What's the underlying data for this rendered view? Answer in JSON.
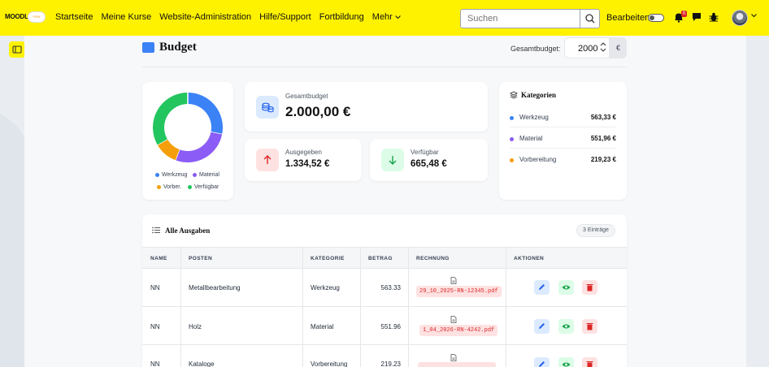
{
  "navbar": {
    "logo_text": "MOODLE",
    "logo_sub": "FRW",
    "links": [
      "Startseite",
      "Meine Kurse",
      "Website-Administration",
      "Hilfe/Support",
      "Fortbildung",
      "Mehr"
    ],
    "search_placeholder": "Suchen",
    "edit_label": "Bearbeiten",
    "notification_count": "0"
  },
  "page": {
    "title": "Budget",
    "budget_label": "Gesamtbudget:",
    "budget_value": "2000",
    "budget_unit": "€"
  },
  "donut": {
    "segments": [
      {
        "label": "Werkzeug",
        "value": 563.33,
        "color": "#3b82f6"
      },
      {
        "label": "Material",
        "value": 551.96,
        "color": "#8b5cf6"
      },
      {
        "label": "Vorber.",
        "value": 219.23,
        "color": "#f59e0b"
      },
      {
        "label": "Verfügbar",
        "value": 665.48,
        "color": "#22c55e"
      }
    ]
  },
  "stats": {
    "total_label": "Gesamtbudget",
    "total_value": "2.000,00 €",
    "spent_label": "Ausgegeben",
    "spent_value": "1.334,52 €",
    "avail_label": "Verfügbar",
    "avail_value": "665,48 €"
  },
  "categories": {
    "title": "Kategorien",
    "items": [
      {
        "name": "Werkzeug",
        "amount": "563,33 €",
        "color": "#3b82f6"
      },
      {
        "name": "Material",
        "amount": "551,96 €",
        "color": "#8b5cf6"
      },
      {
        "name": "Vorbereitung",
        "amount": "219,23 €",
        "color": "#f59e0b"
      }
    ]
  },
  "table": {
    "title": "Alle Ausgaben",
    "count": "3 Einträge",
    "headers": [
      "NAME",
      "POSTEN",
      "KATEGORIE",
      "BETRAG",
      "RECHNUNG",
      "AKTIONEN"
    ],
    "rows": [
      {
        "name": "NN",
        "posten": "Metallbearbeitung",
        "kategorie": "Werkzeug",
        "betrag": "563.33",
        "rechnung": "29_10_2025-RN-12345.pdf"
      },
      {
        "name": "NN",
        "posten": "Holz",
        "kategorie": "Material",
        "betrag": "551.96",
        "rechnung": "1_04_2026-RN-4242.pdf"
      },
      {
        "name": "NN",
        "posten": "Kataloge",
        "kategorie": "Vorbereitung",
        "betrag": "219.23",
        "rechnung": ""
      }
    ]
  },
  "colors": {
    "brand": "#fff200",
    "accent": "#3b82f6",
    "danger": "#dc2626",
    "success": "#22c55e"
  }
}
